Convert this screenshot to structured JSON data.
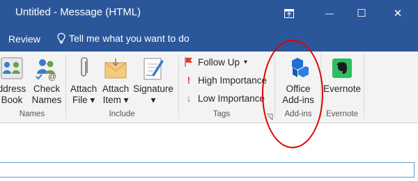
{
  "window": {
    "title": "Untitled  -  Message (HTML)",
    "minimize_glyph": "—",
    "maximize_glyph": "☐",
    "close_glyph": "✕"
  },
  "menu": {
    "review": "Review",
    "tell_me": "Tell me what you want to do"
  },
  "ribbon": {
    "names": {
      "address_book": [
        "ddress",
        "Book"
      ],
      "check_names": [
        "Check",
        "Names"
      ],
      "label": "Names"
    },
    "include": {
      "attach_file": [
        "Attach",
        "File"
      ],
      "attach_item": [
        "Attach",
        "Item"
      ],
      "signature": [
        "Signature",
        ""
      ],
      "label": "Include"
    },
    "tags": {
      "follow_up": "Follow Up",
      "high_importance": "High Importance",
      "low_importance": "Low Importance",
      "label": "Tags"
    },
    "addins": {
      "office_addins": [
        "Office",
        "Add-ins"
      ],
      "label": "Add-ins"
    },
    "evernote": {
      "button": "Evernote",
      "label": "Evernote"
    }
  },
  "colors": {
    "title_bar": "#2b579a",
    "annotation": "#e00000",
    "office_blue": "#1f6fd1",
    "evernote_green": "#2dbe60"
  }
}
